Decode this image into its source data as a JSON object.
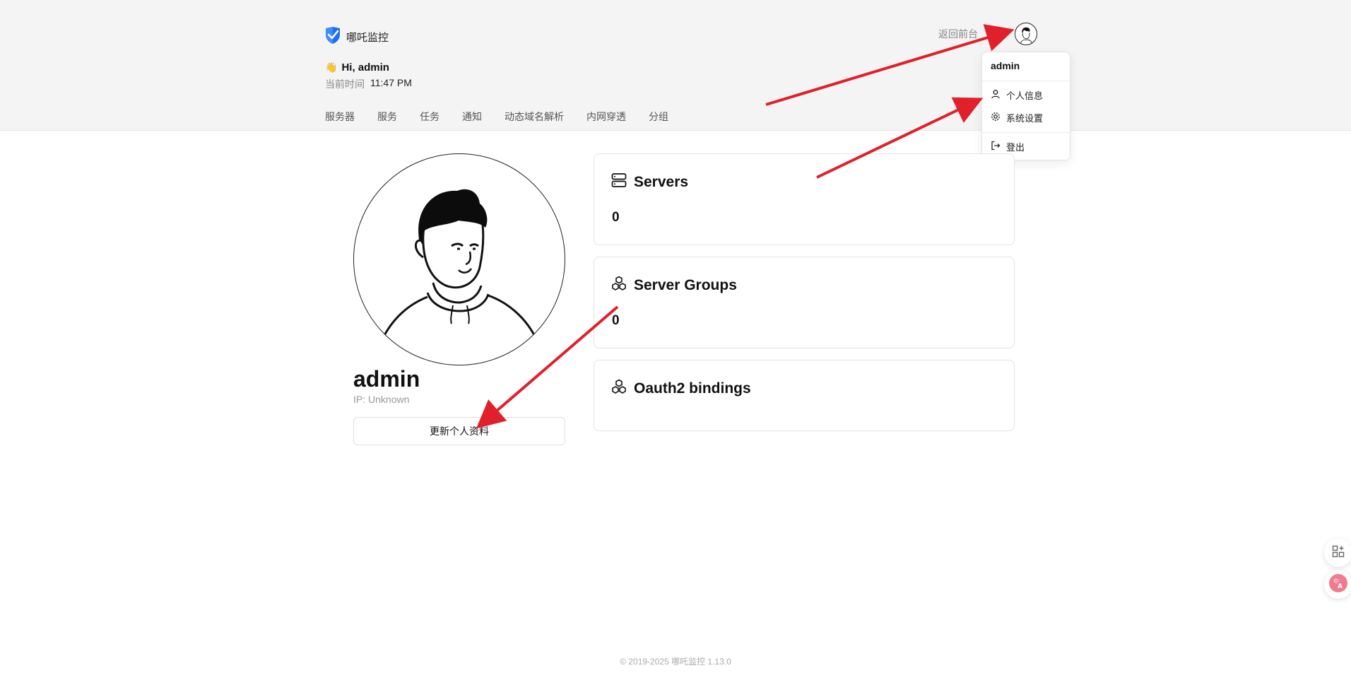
{
  "header": {
    "brand_name": "哪吒监控",
    "brand_icon": "shield-check-icon",
    "greeting_emoji": "👋",
    "greeting": "Hi, admin",
    "time_label": "当前时间",
    "time_value": "11:47 PM",
    "back_link": "返回前台",
    "theme_icon": "sun-icon",
    "avatar_icon": "user-avatar-icon",
    "nav": [
      "服务器",
      "服务",
      "任务",
      "通知",
      "动态域名解析",
      "内网穿透",
      "分组"
    ]
  },
  "dropdown": {
    "username": "admin",
    "items": [
      {
        "label": "个人信息",
        "icon": "user-icon"
      },
      {
        "label": "系统设置",
        "icon": "gear-icon"
      },
      {
        "label": "登出",
        "icon": "logout-icon"
      }
    ]
  },
  "profile": {
    "name": "admin",
    "ip": "IP: Unknown",
    "update_button": "更新个人资料"
  },
  "cards": [
    {
      "title": "Servers",
      "value": "0",
      "icon": "server-icon"
    },
    {
      "title": "Server Groups",
      "value": "0",
      "icon": "cubes-icon"
    },
    {
      "title": "Oauth2 bindings",
      "value": "",
      "icon": "cubes-icon"
    }
  ],
  "footer": "© 2019-2025 哪吒监控 1.13.0",
  "colors": {
    "header_bg": "#f4f4f4",
    "brand_blue": "#1d6ff2",
    "annotation_red": "#e0202a"
  }
}
